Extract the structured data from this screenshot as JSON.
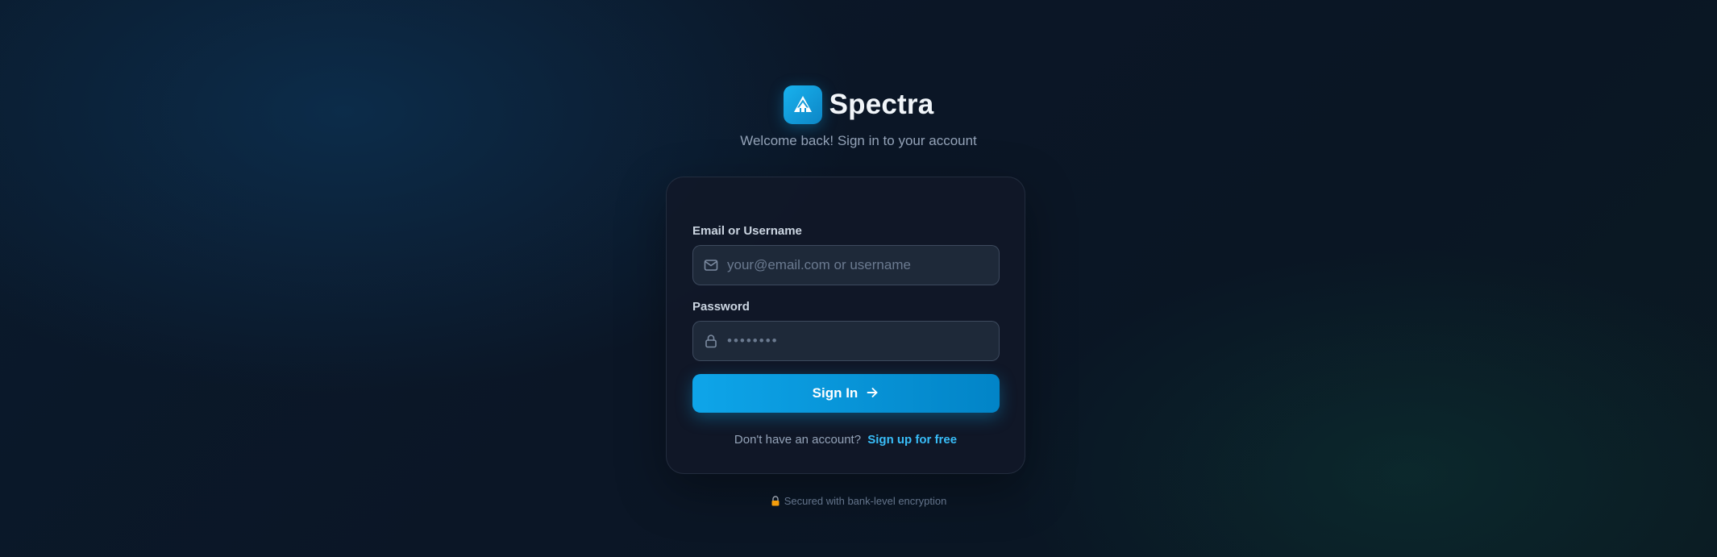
{
  "brand": {
    "name": "Spectra",
    "logo_icon": "spectra-logo-icon",
    "accent_color": "#0ea5e9"
  },
  "subtitle": "Welcome back! Sign in to your account",
  "form": {
    "email": {
      "label": "Email or Username",
      "placeholder": "your@email.com or username",
      "value": "",
      "icon": "mail-icon"
    },
    "password": {
      "label": "Password",
      "placeholder": "••••••••",
      "value": "",
      "icon": "lock-icon"
    },
    "submit": {
      "label": "Sign In",
      "icon": "arrow-right-icon"
    },
    "signup": {
      "prompt": "Don't have an account?",
      "link_label": "Sign up for free",
      "link_color": "#38bdf8"
    }
  },
  "footer": {
    "icon": "padlock-icon",
    "text": "Secured with bank-level encryption"
  }
}
